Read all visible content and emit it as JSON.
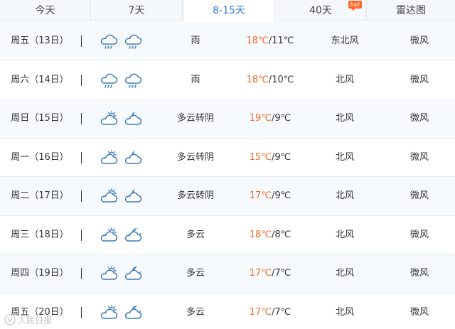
{
  "tabs": [
    {
      "label": "今天",
      "active": false,
      "hot": false
    },
    {
      "label": "7天",
      "active": false,
      "hot": false
    },
    {
      "label": "8-15天",
      "active": true,
      "hot": false
    },
    {
      "label": "40天",
      "active": false,
      "hot": true
    },
    {
      "label": "雷达图",
      "active": false,
      "hot": false
    }
  ],
  "hot_badge": "hot",
  "days": [
    {
      "day": "周五（13日）",
      "icons": [
        "rain-cloud-icon",
        "rain-cloud-icon"
      ],
      "condition": "雨",
      "high": "18℃",
      "low": "11℃",
      "wind_dir": "东北风",
      "wind_level": "微风"
    },
    {
      "day": "周六（14日）",
      "icons": [
        "rain-cloud-icon",
        "rain-cloud-icon"
      ],
      "condition": "雨",
      "high": "18℃",
      "low": "10℃",
      "wind_dir": "北风",
      "wind_level": "微风"
    },
    {
      "day": "周日（15日）",
      "icons": [
        "sun-cloud-icon",
        "moon-cloud-icon"
      ],
      "condition": "多云转阴",
      "high": "19℃",
      "low": "9℃",
      "wind_dir": "北风",
      "wind_level": "微风"
    },
    {
      "day": "周一（16日）",
      "icons": [
        "sun-cloud-icon",
        "moon-cloud-icon"
      ],
      "condition": "多云转阴",
      "high": "15℃",
      "low": "9℃",
      "wind_dir": "北风",
      "wind_level": "微风"
    },
    {
      "day": "周二（17日）",
      "icons": [
        "sun-cloud-icon",
        "moon-cloud-icon"
      ],
      "condition": "多云转阴",
      "high": "17℃",
      "low": "9℃",
      "wind_dir": "北风",
      "wind_level": "微风"
    },
    {
      "day": "周三（18日）",
      "icons": [
        "sun-cloud-icon",
        "crescent-cloud-icon"
      ],
      "condition": "多云",
      "high": "18℃",
      "low": "8℃",
      "wind_dir": "北风",
      "wind_level": "微风"
    },
    {
      "day": "周四（19日）",
      "icons": [
        "sun-cloud-icon",
        "crescent-cloud-icon"
      ],
      "condition": "多云",
      "high": "17℃",
      "low": "7℃",
      "wind_dir": "北风",
      "wind_level": "微风"
    },
    {
      "day": "周五（20日）",
      "icons": [
        "sun-cloud-icon",
        "crescent-cloud-icon"
      ],
      "condition": "多云",
      "high": "17℃",
      "low": "7℃",
      "wind_dir": "北风",
      "wind_level": "微风"
    }
  ],
  "temp_separator": "/",
  "watermark": "人民日报",
  "colors": {
    "accent": "#3a7bd5",
    "high_temp": "#ef6b2b",
    "icon": "#3d7bb8",
    "hot": "#ff6a2a"
  }
}
